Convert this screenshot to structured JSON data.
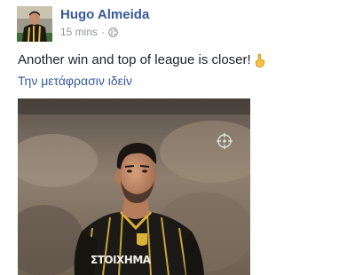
{
  "post": {
    "author_name": "Hugo Almeida",
    "timestamp": "15 mins",
    "separator": "·",
    "audience_icon": "globe-icon",
    "text": "Another win and top of league is closer!",
    "emoji_icon": "pointing-up-finger-icon",
    "see_translation_label": "Την μετάφρασιν ιδείν",
    "photo": {
      "description_icon": "player-photo",
      "jersey_text": "ΣΤΟΙΧΗΜΑ",
      "target_icon": "crosshair-icon"
    }
  },
  "colors": {
    "link": "#365899",
    "body_text": "#1d2129",
    "meta_text": "#90949c",
    "jersey": "#1c1a16",
    "jersey_stripe": "#d8b13a"
  }
}
